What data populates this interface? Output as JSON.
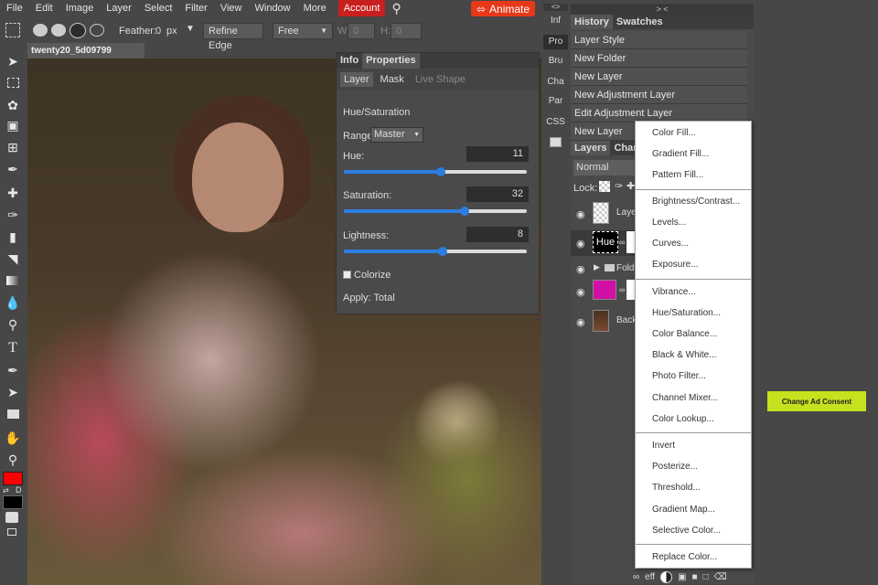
{
  "menubar": {
    "items": [
      "File",
      "Edit",
      "Image",
      "Layer",
      "Select",
      "Filter",
      "View",
      "Window",
      "More"
    ],
    "account": "Account",
    "animate": "Animate"
  },
  "optbar": {
    "feather_label": "Feather:",
    "feather_value": "0",
    "feather_unit": "px",
    "refine_edge": "Refine Edge",
    "style": "Free",
    "w_label": "W:",
    "w_value": "0",
    "h_label": "H:",
    "h_value": "0"
  },
  "doc": {
    "tab": "twenty20_5d09799"
  },
  "properties": {
    "tabs": [
      "Info",
      "Properties"
    ],
    "subtabs": [
      "Layer",
      "Mask",
      "Live Shape"
    ],
    "title": "Hue/Saturation",
    "range_label": "Range:",
    "range_value": "Master",
    "hue_label": "Hue:",
    "hue_value": "11",
    "saturation_label": "Saturation:",
    "saturation_value": "32",
    "lightness_label": "Lightness:",
    "lightness_value": "8",
    "colorize": "Colorize",
    "apply": "Apply: Total",
    "sliders": {
      "hue": 0.53,
      "saturation": 0.66,
      "lightness": 0.54
    }
  },
  "strip": {
    "collapse": "<>",
    "items": [
      "Inf",
      "Pro",
      "Bru",
      "Cha",
      "Par",
      "CSS"
    ]
  },
  "history": {
    "collapse": "> <",
    "tabs": [
      "History",
      "Swatches"
    ],
    "items": [
      "Layer Style",
      "New Folder",
      "New Layer",
      "New Adjustment Layer",
      "Edit Adjustment Layer",
      "New Layer"
    ]
  },
  "layers": {
    "tabs": [
      "Layers",
      "Chan"
    ],
    "blend": "Normal",
    "lock": "Lock:",
    "rows": [
      {
        "name": "Laye"
      },
      {
        "name": "Hue"
      },
      {
        "name": "Fold"
      },
      {
        "name": ""
      },
      {
        "name": "Back"
      }
    ]
  },
  "menu": {
    "items": [
      "Color Fill...",
      "Gradient Fill...",
      "Pattern Fill...",
      "Brightness/Contrast...",
      "Levels...",
      "Curves...",
      "Exposure...",
      "Vibrance...",
      "Hue/Saturation...",
      "Color Balance...",
      "Black & White...",
      "Photo Filter...",
      "Channel Mixer...",
      "Color Lookup...",
      "Invert",
      "Posterize...",
      "Threshold...",
      "Gradient Map...",
      "Selective Color...",
      "Replace Color..."
    ]
  },
  "bottombar": {
    "eff": "eff"
  },
  "ad": {
    "label": "Change Ad Consent"
  },
  "colors": {
    "foreground": "#ff0000",
    "background": "#000000",
    "accent": "#2b7de0",
    "account": "#c8201e",
    "animate": "#e8381a",
    "ad": "#c6e11d"
  }
}
